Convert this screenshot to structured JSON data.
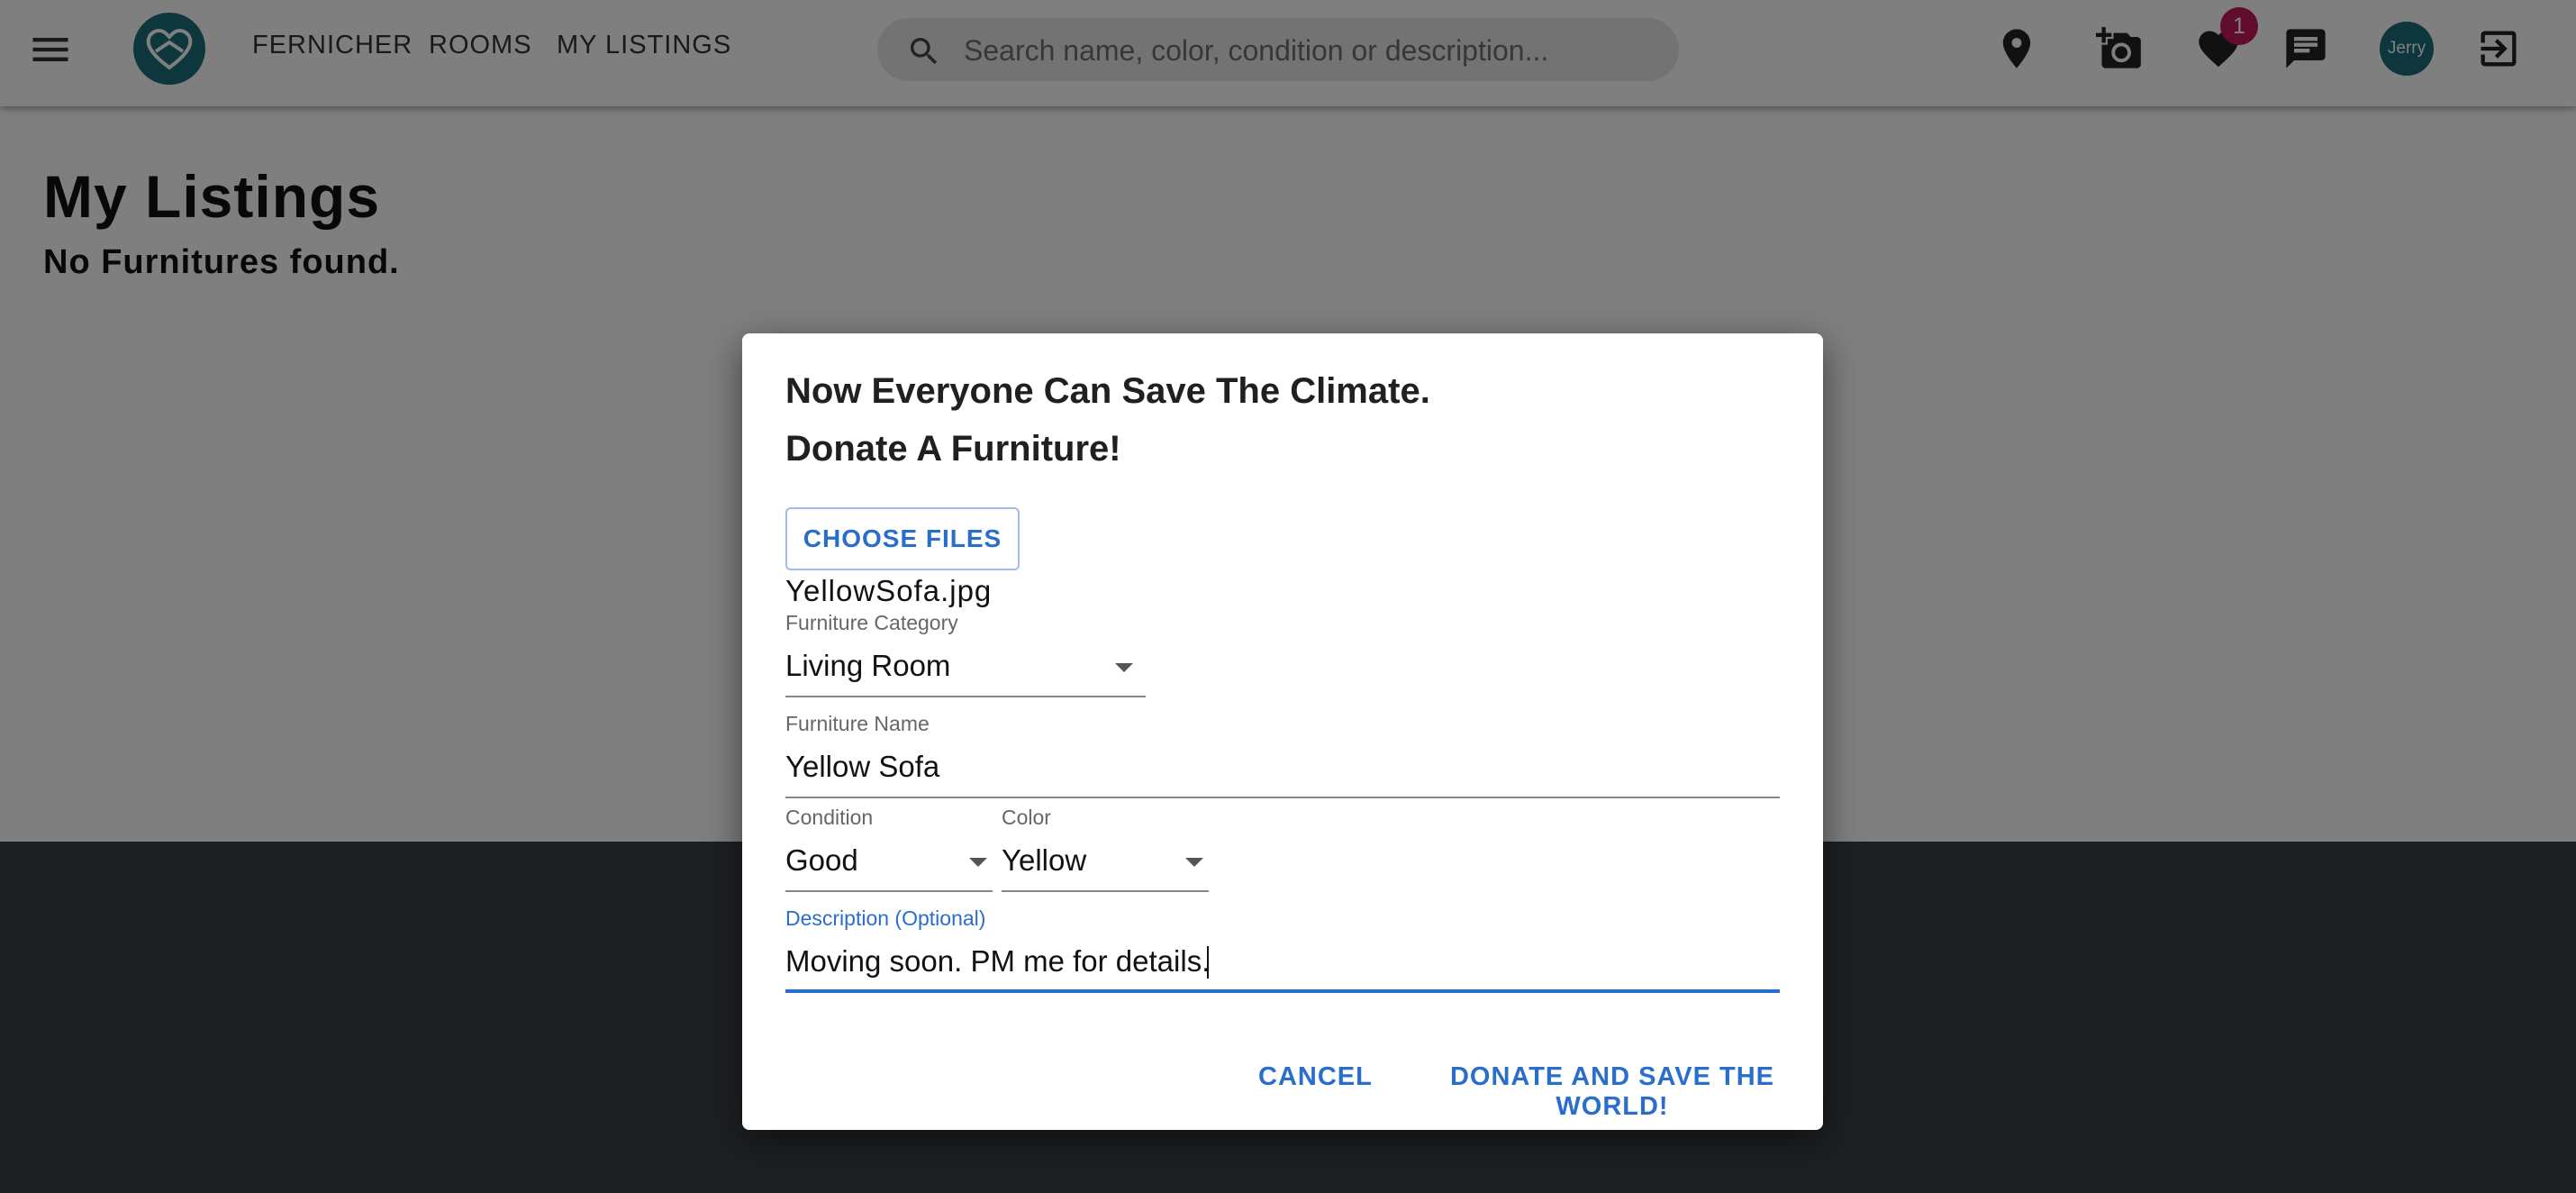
{
  "appbar": {
    "nav": [
      "FERNICHER",
      "ROOMS",
      "MY LISTINGS"
    ],
    "search_placeholder": "Search name, color, condition or description...",
    "icons": [
      "menu-icon",
      "app-logo",
      "search-icon",
      "location-pin-icon",
      "add-photo-icon",
      "favorite-heart-icon",
      "message-icon",
      "logout-icon"
    ],
    "favorites_badge": "1",
    "avatar_label": "Jerry"
  },
  "page": {
    "title": "My Listings",
    "empty_text": "No Furnitures found."
  },
  "dialog": {
    "title_line1": "Now Everyone Can Save The Climate.",
    "title_line2": "Donate A Furniture!",
    "choose_files_label": "CHOOSE FILES",
    "file_name": "YellowSofa.jpg",
    "category_label": "Furniture Category",
    "category_value": "Living Room",
    "name_label": "Furniture Name",
    "name_value": "Yellow Sofa",
    "condition_label": "Condition",
    "condition_value": "Good",
    "color_label": "Color",
    "color_value": "Yellow",
    "description_label": "Description (Optional)",
    "description_value": "Moving soon. PM me for details.",
    "cancel_label": "CANCEL",
    "submit_label": "DONATE AND SAVE THE WORLD!"
  },
  "colors": {
    "accent": "#2a6ecc",
    "brand": "#1b6f78",
    "badge": "#c2185b",
    "footer": "#3a4046"
  }
}
